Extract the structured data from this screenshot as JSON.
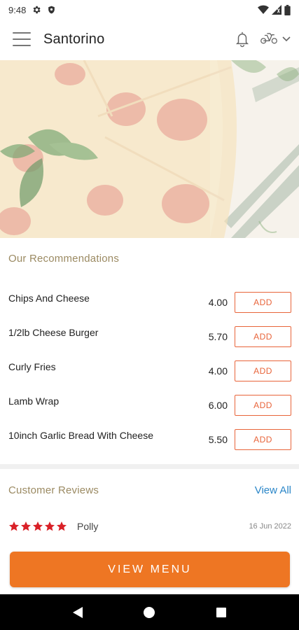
{
  "status_bar": {
    "time": "9:48"
  },
  "header": {
    "title": "Santorino"
  },
  "recommendations": {
    "title": "Our Recommendations",
    "items": [
      {
        "name": "Chips And Cheese",
        "price": "4.00",
        "add_label": "ADD"
      },
      {
        "name": "1/2lb Cheese Burger",
        "price": "5.70",
        "add_label": "ADD"
      },
      {
        "name": "Curly Fries",
        "price": "4.00",
        "add_label": "ADD"
      },
      {
        "name": "Lamb Wrap",
        "price": "6.00",
        "add_label": "ADD"
      },
      {
        "name": "10inch Garlic Bread With Cheese",
        "price": "5.50",
        "add_label": "ADD"
      }
    ]
  },
  "reviews": {
    "title": "Customer Reviews",
    "view_all_label": "View All",
    "items": [
      {
        "rating": 5,
        "reviewer": "Polly",
        "date": "16 Jun 2022"
      }
    ]
  },
  "view_menu_label": "VIEW MENU",
  "colors": {
    "accent": "#ee7623",
    "add_button": "#e8643a",
    "section_title": "#9b8a62",
    "link": "#2a86c8",
    "star": "#d92027"
  },
  "icons": {
    "status": [
      "settings-icon",
      "shield-icon",
      "wifi-icon",
      "signal-icon",
      "battery-icon"
    ],
    "header": [
      "menu-icon",
      "bell-icon",
      "scooter-icon",
      "chevron-down-icon"
    ],
    "nav": [
      "back-icon",
      "home-icon",
      "recents-icon"
    ]
  }
}
